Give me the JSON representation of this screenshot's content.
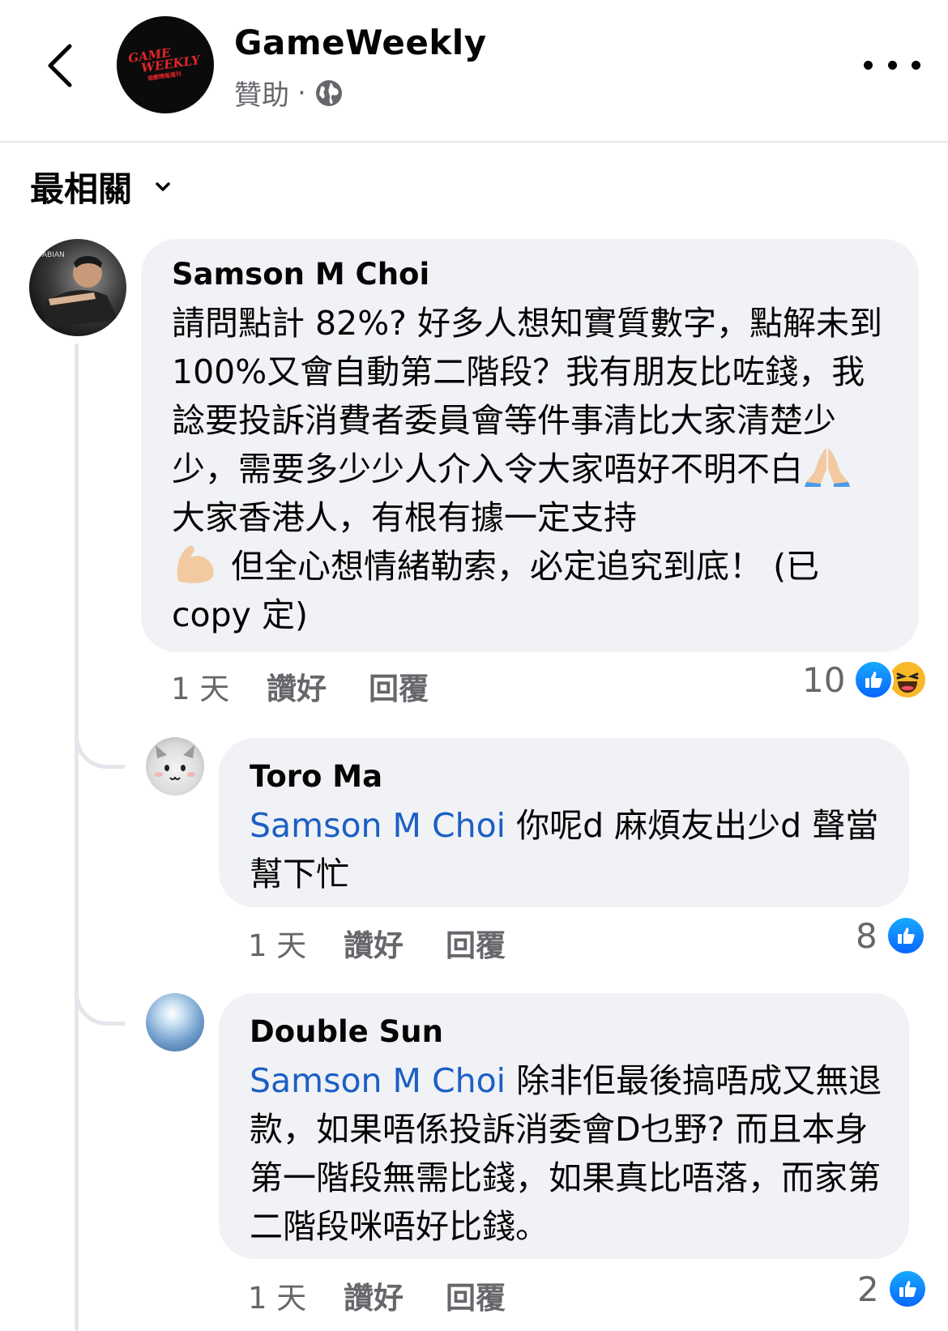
{
  "header": {
    "page_name": "GameWeekly",
    "sponsored": "贊助",
    "dot": "·",
    "avatar_logo_line1": "GAME",
    "avatar_logo_line2": "WEEKLY",
    "avatar_logo_sub": "遊戲情報週刊"
  },
  "sort": {
    "label": "最相關",
    "icon": "chevron-down-icon"
  },
  "comments": [
    {
      "author": "Samson M Choi",
      "text_1": "請問點計 82%? 好多人想知實質數字，點解未到100%又會自動第二階段？我有朋友比咗錢，我諗要投訴消費者委員會等件事清比大家清楚少少，需要多少少人介入令大家唔好不明不白",
      "text_2": " 大家香港人，有根有據一定支持",
      "text_3": " 但全心想情緒勒索，必定追究到底！ (已copy 定)",
      "time": "1 天",
      "like": "讚好",
      "reply": "回覆",
      "reaction_count": "10",
      "reactions": [
        "like",
        "haha"
      ]
    },
    {
      "author": "Toro Ma",
      "mention": "Samson M Choi",
      "text": " 你呢d 麻煩友出少d 聲當幫下忙",
      "time": "1 天",
      "like": "讚好",
      "reply": "回覆",
      "reaction_count": "8",
      "reactions": [
        "like"
      ]
    },
    {
      "author": "Double Sun",
      "mention": "Samson M Choi",
      "text": " 除非佢最後搞唔成又無退款，如果唔係投訴消委會D乜野? 而且本身第一階段無需比錢，如果真比唔落，而家第二階段咪唔好比錢。",
      "time": "1 天",
      "like": "讚好",
      "reply": "回覆",
      "reaction_count": "2",
      "reactions": [
        "like"
      ]
    }
  ],
  "colors": {
    "mention": "#1c5fc5",
    "bubble": "#f0f2f5",
    "secondary_text": "#65676b",
    "like_blue": "#0866ff"
  }
}
